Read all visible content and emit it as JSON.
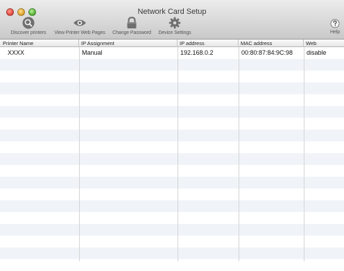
{
  "window": {
    "title": "Network Card Setup"
  },
  "toolbar": {
    "discover": {
      "label": "Discover printers",
      "icon": "magnifier-icon"
    },
    "view_pages": {
      "label": "View Printer Web Pages",
      "icon": "eye-icon"
    },
    "change_password": {
      "label": "Change Password",
      "icon": "lock-icon"
    },
    "device_settings": {
      "label": "Device Settings",
      "icon": "gear-icon"
    },
    "help": {
      "label": "Help",
      "icon": "question-icon"
    }
  },
  "table": {
    "columns": [
      "Printer Name",
      "IP Assignment",
      "IP address",
      "MAC address",
      "Web"
    ],
    "rows": [
      [
        "XXXX",
        "Manual",
        "192.168.0.2",
        "00:80:87:84:9C:98",
        "disable"
      ]
    ]
  }
}
